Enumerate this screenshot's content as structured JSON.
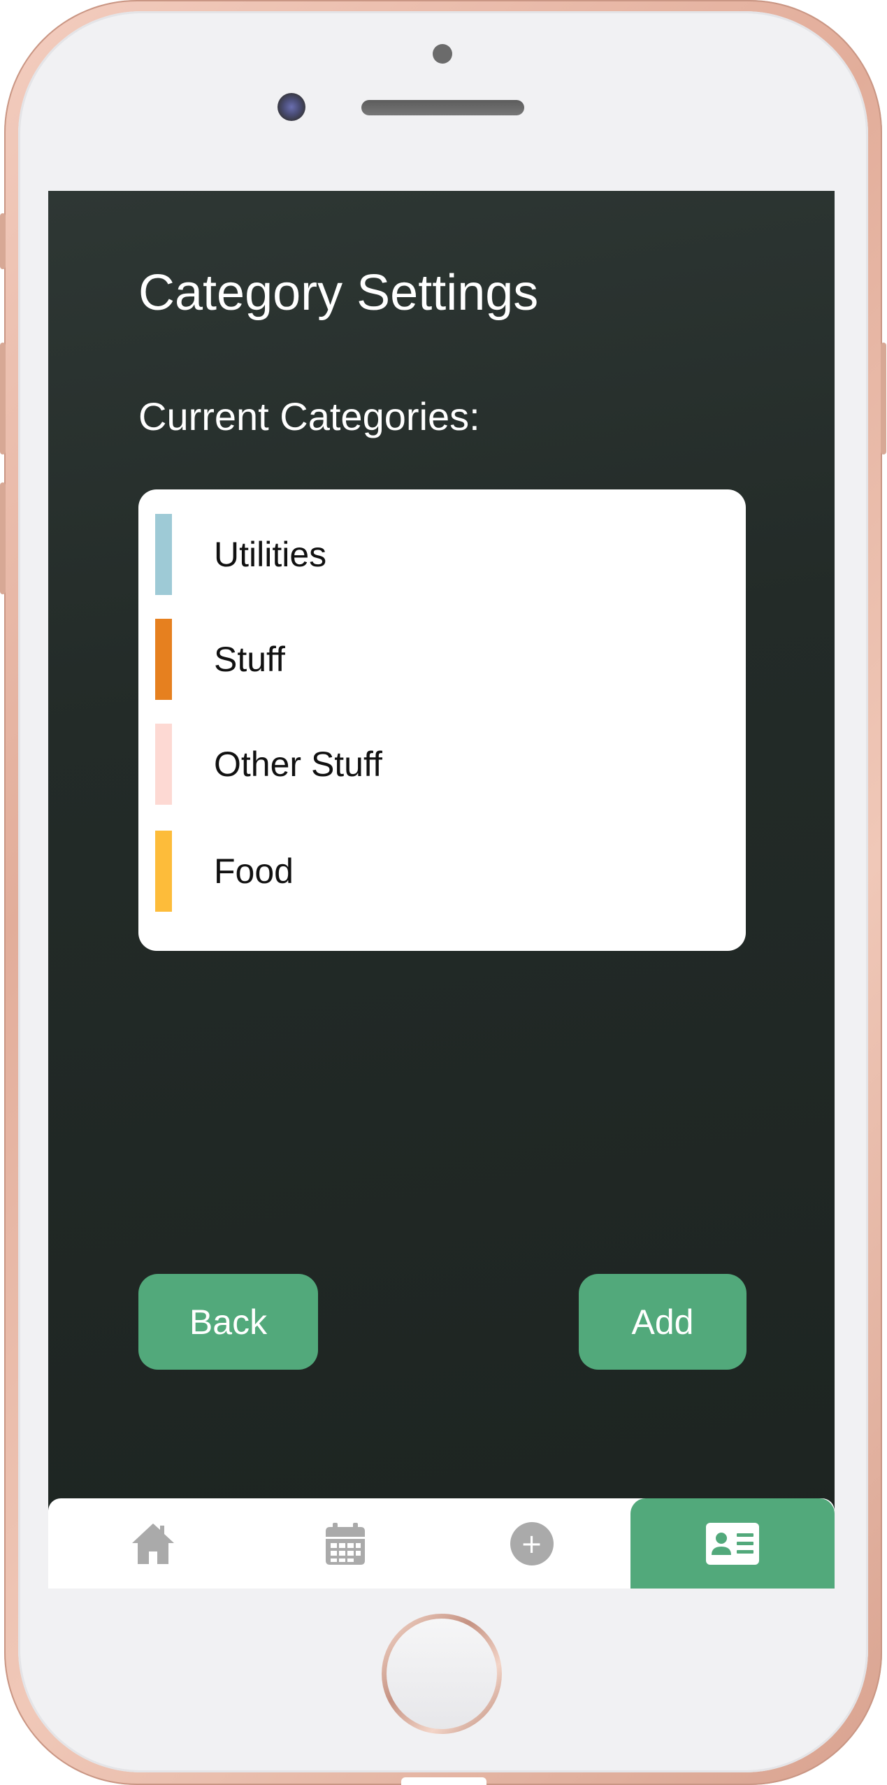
{
  "screen": {
    "title": "Category Settings",
    "section_label": "Current Categories:"
  },
  "categories": [
    {
      "label": "Utilities",
      "color": "#9ecad6"
    },
    {
      "label": "Stuff",
      "color": "#e6801f"
    },
    {
      "label": "Other Stuff",
      "color": "#fdd9d3"
    },
    {
      "label": "Food",
      "color": "#fdbc3a"
    }
  ],
  "buttons": {
    "back_label": "Back",
    "add_label": "Add"
  },
  "nav": {
    "items": [
      {
        "icon": "home-icon",
        "active": false
      },
      {
        "icon": "calendar-icon",
        "active": false
      },
      {
        "icon": "plus-circle-icon",
        "active": false,
        "glyph": "+"
      },
      {
        "icon": "contact-card-icon",
        "active": true
      }
    ]
  },
  "colors": {
    "accent": "#52a97b",
    "background": "#222a27",
    "icon_inactive": "#aaaaaa"
  }
}
